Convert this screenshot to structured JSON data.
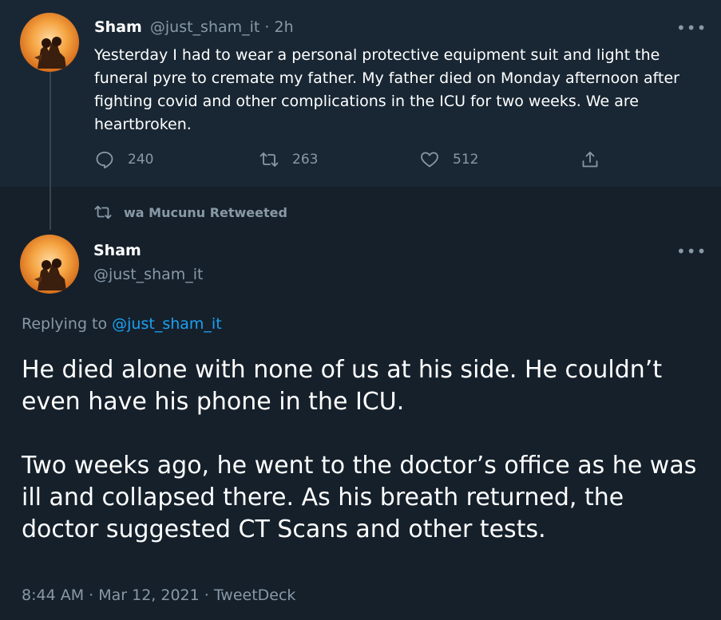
{
  "top_tweet": {
    "author_name": "Sham",
    "author_handle": "@just_sham_it",
    "separator": " · ",
    "time": "2h",
    "more": "•••",
    "text": "Yesterday I had to wear a personal protective equipment suit and light the funeral pyre to cremate my father.  My father died on Monday afternoon after fighting covid and other complications in the ICU for two weeks. We are heartbroken.",
    "actions": {
      "reply_count": "240",
      "retweet_count": "263",
      "like_count": "512"
    }
  },
  "retweet_banner": {
    "label": "wa Mucunu Retweeted"
  },
  "main_tweet": {
    "author_name": "Sham",
    "author_handle": "@just_sham_it",
    "more": "•••",
    "replying_prefix": "Replying to ",
    "replying_handle": "@just_sham_it",
    "text": "He died alone with none of us at his side. He couldn’t even have his phone in the ICU.\n\nTwo weeks ago, he went to the doctor’s office as he was ill and collapsed there. As his breath returned, the doctor suggested CT Scans and other tests.",
    "meta": "8:44 AM · Mar 12, 2021 · TweetDeck"
  },
  "colors": {
    "background": "#15202b",
    "top_tweet_background": "#192734",
    "muted": "#8899a6",
    "link": "#1da1f2"
  },
  "icons": [
    "avatar",
    "more-icon",
    "reply-icon",
    "retweet-icon",
    "like-icon",
    "share-icon"
  ]
}
